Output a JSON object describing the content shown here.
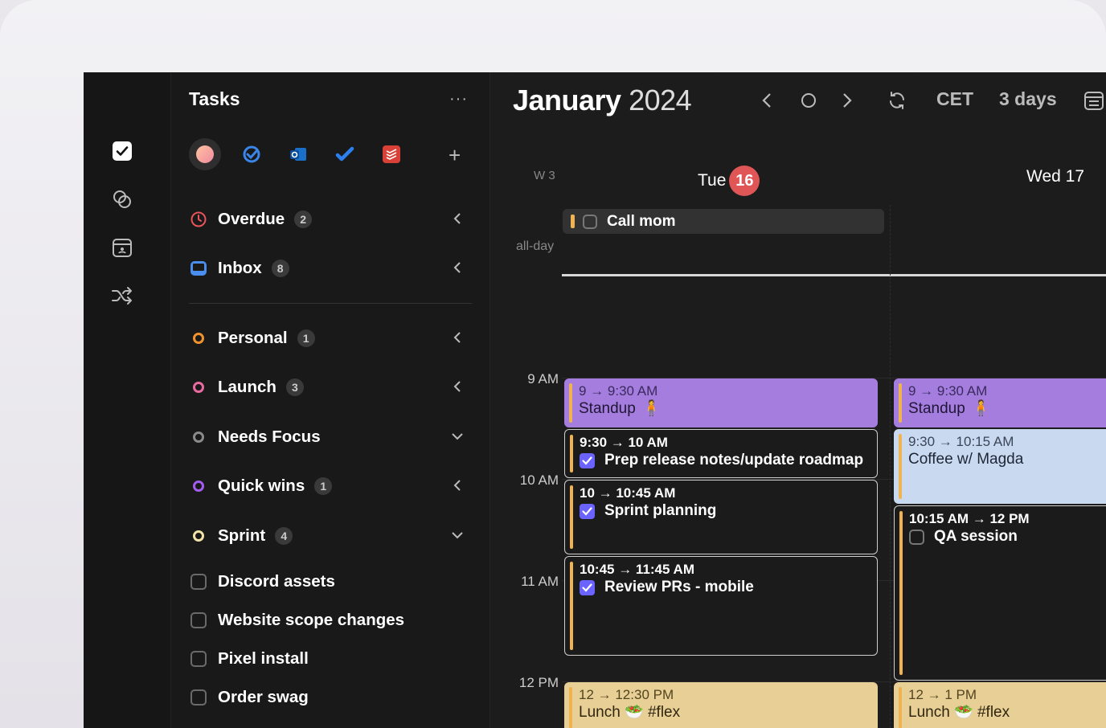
{
  "sidebar": {
    "title": "Tasks",
    "more": "···",
    "add": "+",
    "smart_lists": [
      {
        "label": "Overdue",
        "count": "2"
      },
      {
        "label": "Inbox",
        "count": "8"
      }
    ],
    "projects": [
      {
        "label": "Personal",
        "count": "1",
        "color": "#f0922e"
      },
      {
        "label": "Launch",
        "count": "3",
        "color": "#e86aa0"
      },
      {
        "label": "Needs Focus",
        "count": "",
        "color": "#8a8a8a"
      },
      {
        "label": "Quick wins",
        "count": "1",
        "color": "#a45cf0"
      },
      {
        "label": "Sprint",
        "count": "4",
        "color": "#f3e2a8"
      }
    ],
    "tasks": [
      "Discord assets",
      "Website scope changes",
      "Pixel install",
      "Order swag"
    ]
  },
  "calendar": {
    "month": "January",
    "year": "2024",
    "timezone": "CET",
    "view": "3 days",
    "week": "W 3",
    "days": [
      {
        "name": "Tue",
        "num": "16"
      },
      {
        "name": "Wed 17"
      }
    ],
    "allday_label": "all-day",
    "allday_event": "Call mom",
    "hours": [
      "9 AM",
      "10 AM",
      "11 AM",
      "12 PM"
    ],
    "events_tue": [
      {
        "time": "9 → 9:30 AM",
        "title": "Standup"
      },
      {
        "time": "9:30 → 10 AM",
        "title": "Prep release notes/update roadmap"
      },
      {
        "time": "10 → 10:45 AM",
        "title": "Sprint planning"
      },
      {
        "time": "10:45 → 11:45 AM",
        "title": "Review PRs - mobile"
      },
      {
        "time": "12 → 12:30 PM",
        "title": "Lunch 🥗 #flex"
      }
    ],
    "events_wed": [
      {
        "time": "9 → 9:30 AM",
        "title": "Standup"
      },
      {
        "time": "9:30 → 10:15 AM",
        "title": "Coffee w/ Magda"
      },
      {
        "time": "10:15 AM → 12 PM",
        "title": "QA session"
      },
      {
        "time": "12 → 1 PM",
        "title": "Lunch 🥗 #flex"
      }
    ]
  },
  "colors": {
    "accent": "#6a63ff",
    "today": "#e05555",
    "standup": "#a47ddf",
    "lunch": "#e7cf95",
    "coffee": "#c9daf0"
  }
}
